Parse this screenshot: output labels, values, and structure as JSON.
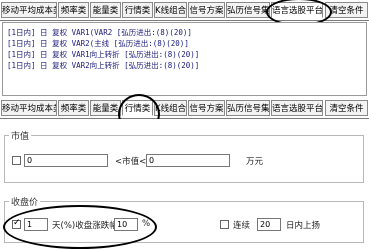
{
  "top_tabs": [
    "移动平均成本类",
    "频率类",
    "能量类",
    "行情类",
    "K线组合",
    "信号方案",
    "弘历信号集",
    "语言选股平台",
    "清空条件"
  ],
  "conditions": [
    "[1日内]  日  复权  VAR1(VAR2  [弘历进出:(8)(20)]",
    "[1日内]  日  复权  VAR2(主线  [弘历进出:(8)(20)]",
    "[1日内]  日  复权  VAR1向上转折  [弘历进出:(8)(20)]",
    "[1日内]  日  复权  VAR2向上转折  [弘历进出:(8)(20)]"
  ],
  "mid_tabs": [
    "移动平均成本类",
    "频率类",
    "能量类",
    "行情类",
    "K线组合",
    "信号方案",
    "弘历信号集",
    "语言选股平台",
    "清空条件"
  ],
  "market_value": {
    "group_title": "市值",
    "from_value": "0",
    "to_label": "<市值<",
    "to_value": "0",
    "unit": "万元"
  },
  "close_price": {
    "group_title": "收盘价",
    "days_value": "1",
    "condition_label": "天(%)收盘涨跌幅度(",
    "pct_value": "10",
    "pct_unit": "%",
    "consecutive_label": "连续",
    "consecutive_value": "20",
    "trend_label": "日内上扬"
  }
}
